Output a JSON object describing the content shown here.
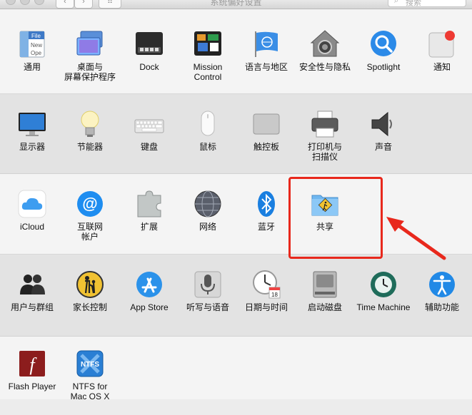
{
  "window": {
    "title": "系统偏好设置",
    "search_placeholder": "搜索",
    "back_glyph": "‹",
    "forward_glyph": "›",
    "grid_glyph": "⠿"
  },
  "sections": [
    {
      "items": [
        {
          "label": "通用",
          "icon": "general-icon"
        },
        {
          "label": "桌面与\n屏幕保护程序",
          "icon": "desktop-screensaver-icon"
        },
        {
          "label": "Dock",
          "icon": "dock-icon"
        },
        {
          "label": "Mission\nControl",
          "icon": "mission-control-icon"
        },
        {
          "label": "语言与地区",
          "icon": "language-region-icon"
        },
        {
          "label": "安全性与隐私",
          "icon": "security-privacy-icon"
        },
        {
          "label": "Spotlight",
          "icon": "spotlight-icon"
        },
        {
          "label": "通知",
          "icon": "notifications-icon"
        }
      ]
    },
    {
      "items": [
        {
          "label": "显示器",
          "icon": "displays-icon"
        },
        {
          "label": "节能器",
          "icon": "energy-saver-icon"
        },
        {
          "label": "键盘",
          "icon": "keyboard-icon"
        },
        {
          "label": "鼠标",
          "icon": "mouse-icon"
        },
        {
          "label": "触控板",
          "icon": "trackpad-icon"
        },
        {
          "label": "打印机与\n扫描仪",
          "icon": "printers-scanners-icon"
        },
        {
          "label": "声音",
          "icon": "sound-icon"
        }
      ]
    },
    {
      "items": [
        {
          "label": "iCloud",
          "icon": "icloud-icon"
        },
        {
          "label": "互联网\n帐户",
          "icon": "internet-accounts-icon"
        },
        {
          "label": "扩展",
          "icon": "extensions-icon"
        },
        {
          "label": "网络",
          "icon": "network-icon"
        },
        {
          "label": "蓝牙",
          "icon": "bluetooth-icon"
        },
        {
          "label": "共享",
          "icon": "sharing-icon"
        }
      ]
    },
    {
      "items": [
        {
          "label": "用户与群组",
          "icon": "users-groups-icon"
        },
        {
          "label": "家长控制",
          "icon": "parental-controls-icon"
        },
        {
          "label": "App Store",
          "icon": "app-store-icon"
        },
        {
          "label": "听写与语音",
          "icon": "dictation-speech-icon"
        },
        {
          "label": "日期与时间",
          "icon": "date-time-icon"
        },
        {
          "label": "启动磁盘",
          "icon": "startup-disk-icon"
        },
        {
          "label": "Time Machine",
          "icon": "time-machine-icon"
        },
        {
          "label": "辅助功能",
          "icon": "accessibility-icon"
        }
      ]
    },
    {
      "items": [
        {
          "label": "Flash Player",
          "icon": "flash-player-icon"
        },
        {
          "label": "NTFS for\nMac OS X",
          "icon": "ntfs-icon"
        }
      ]
    }
  ],
  "icon_text": {
    "file": "File",
    "new": "New",
    "open": "Ope",
    "calendar_day": "18",
    "flash": "f",
    "ntfs": "NTFS"
  },
  "colors": {
    "highlight": "#e8281c",
    "accent_blue": "#1a8be6"
  }
}
